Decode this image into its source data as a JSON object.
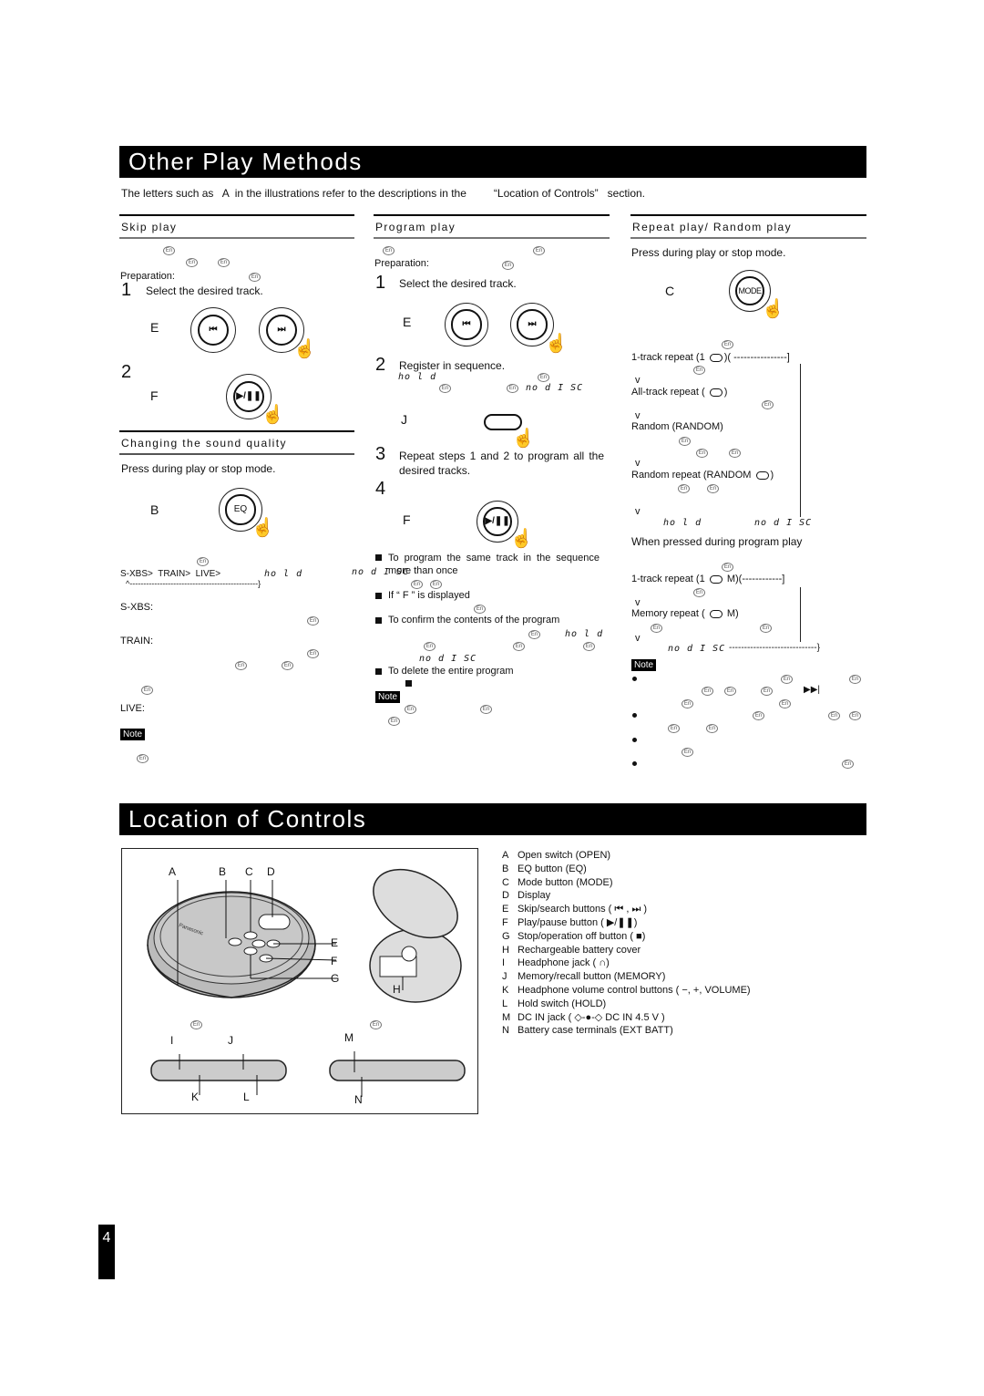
{
  "sections": {
    "other_play": {
      "title": "Other Play Methods",
      "intro_prefix": "The letters such as",
      "intro_letter": "A",
      "intro_mid": "in the illustrations refer to the descriptions in the",
      "intro_ref": "“Location of Controls”",
      "intro_suffix": "section."
    },
    "location": {
      "title": "Location of Controls"
    }
  },
  "skip_play": {
    "heading": "Skip play",
    "preparation": "Preparation:",
    "step1_num": "1",
    "step1_text": "Select the desired track.",
    "letter_e": "E",
    "step2_num": "2",
    "letter_f": "F",
    "prev_icon": "⏮",
    "next_icon": "⏭",
    "play_pause_icon": "▶/❚❚"
  },
  "sound_quality": {
    "heading": "Changing the sound quality",
    "instruction": "Press during play or stop mode.",
    "letter_b": "B",
    "eq_label": "EQ",
    "cycle": "S-XBS>  TRAIN>  LIVE>",
    "cycle_return": "^-----------------------------------------------}",
    "lcd_hold": "ho l d",
    "terms": [
      "S-XBS:",
      "TRAIN:",
      "LIVE:"
    ],
    "note_label": "Note"
  },
  "program_play": {
    "heading": "Program play",
    "preparation": "Preparation:",
    "step1_num": "1",
    "step1_text": "Select the desired track.",
    "letter_e": "E",
    "step2_num": "2",
    "step2_text": "Register in sequence.",
    "lcd_hold": "ho l d",
    "lcd_nodisc": "no d I SC",
    "letter_j": "J",
    "step3_num": "3",
    "step3_text": "Repeat steps 1 and 2 to program all the desired tracks.",
    "step4_num": "4",
    "letter_f": "F",
    "bullets": [
      "To program the same track in the sequence more than once",
      "If “ F ” is displayed",
      "To confirm the contents of the program",
      "To delete the entire program"
    ],
    "note_label": "Note"
  },
  "repeat_random": {
    "heading": "Repeat play/ Random play",
    "instruction": "Press during play or stop mode.",
    "letter_c": "C",
    "mode_label": "MODE",
    "modes": [
      "1-track repeat (1",
      "All-track repeat (",
      "Random (RANDOM)",
      "Random repeat (RANDOM"
    ],
    "arrow": "v",
    "lcd_hold": "ho l d",
    "lcd_nodisc": "no d I SC",
    "program_heading": "When pressed during program play",
    "program_modes": [
      "1-track repeat (1",
      "Memory repeat ("
    ],
    "program_m": "M)",
    "lcd_m": "M",
    "note_label": "Note",
    "next_icon": "▶▶|"
  },
  "controls": {
    "diagram_labels": [
      "A",
      "B",
      "C",
      "D",
      "E",
      "F",
      "G",
      "H",
      "I",
      "J",
      "K",
      "L",
      "M",
      "N"
    ],
    "brand": "Panasonic",
    "items": [
      {
        "key": "A",
        "label": "Open switch (OPEN)"
      },
      {
        "key": "B",
        "label": "EQ button (EQ)"
      },
      {
        "key": "C",
        "label": "Mode button (MODE)"
      },
      {
        "key": "D",
        "label": "Display"
      },
      {
        "key": "E",
        "label": "Skip/search buttons (  ⏮ ,  ⏭ )"
      },
      {
        "key": "F",
        "label": "Play/pause button (  ▶/❚❚)"
      },
      {
        "key": "G",
        "label": "Stop/operation off button (   ■)"
      },
      {
        "key": "H",
        "label": "Rechargeable battery cover"
      },
      {
        "key": "I",
        "label": "Headphone jack ( ∩)"
      },
      {
        "key": "J",
        "label": "Memory/recall button (MEMORY)"
      },
      {
        "key": "K",
        "label": "Headphone volume control buttons (    −, +, VOLUME)"
      },
      {
        "key": "L",
        "label": "Hold switch (HOLD)"
      },
      {
        "key": "M",
        "label": "DC IN jack ( ◇-●-◇ DC IN 4.5 V )"
      },
      {
        "key": "N",
        "label": "Battery case terminals (EXT BATT)"
      }
    ]
  },
  "en_badge": "En",
  "page_number": "4"
}
